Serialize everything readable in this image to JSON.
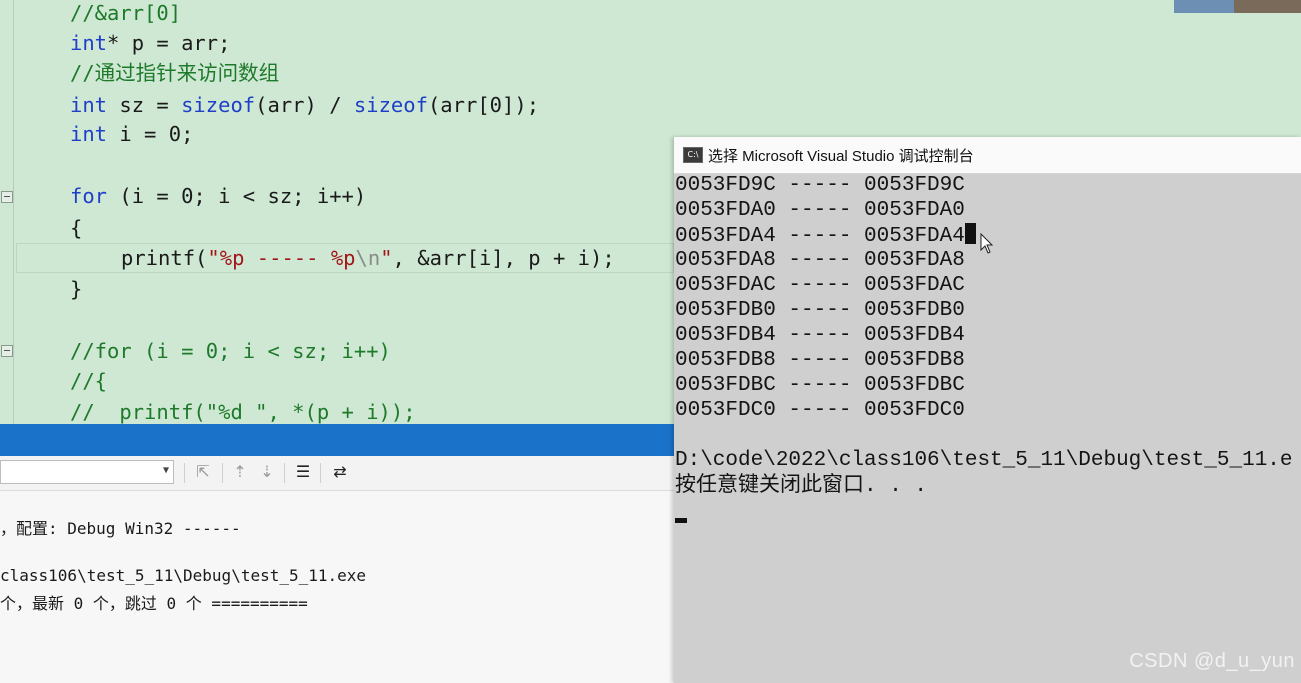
{
  "editor": {
    "lines": [
      "//&arr[0]",
      "int* p = arr;",
      "//通过指针来访问数组",
      "int sz = sizeof(arr) / sizeof(arr[0]);",
      "int i = 0;",
      "for (i = 0; i < sz; i++)",
      "{",
      "printf(\"%p ----- %p\\n\", &arr[i], p + i);",
      "}",
      "//for (i = 0; i < sz; i++)",
      "//{",
      "//  printf(\"%d \", *(p + i));"
    ]
  },
  "output": {
    "lines": [
      "，配置: Debug Win32 ------",
      "class106\\test_5_11\\Debug\\test_5_11.exe",
      "个，最新 0 个，跳过 0 个 =========="
    ]
  },
  "console": {
    "title": "选择 Microsoft Visual Studio 调试控制台",
    "rows": [
      "0053FD9C ----- 0053FD9C",
      "0053FDA0 ----- 0053FDA0",
      "0053FDA4 ----- 0053FDA4",
      "0053FDA8 ----- 0053FDA8",
      "0053FDAC ----- 0053FDAC",
      "0053FDB0 ----- 0053FDB0",
      "0053FDB4 ----- 0053FDB4",
      "0053FDB8 ----- 0053FDB8",
      "0053FDBC ----- 0053FDBC",
      "0053FDC0 ----- 0053FDC0"
    ],
    "path": "D:\\code\\2022\\class106\\test_5_11\\Debug\\test_5_11.e",
    "prompt": "按任意键关闭此窗口. . ."
  },
  "watermark": "CSDN @d_u_yun",
  "colors": {
    "editor_bg": "#cfe8d4",
    "keyword": "#1f3fc8",
    "comment": "#1e7a2a",
    "string": "#a3151a",
    "output_bar": "#1a72c9"
  }
}
